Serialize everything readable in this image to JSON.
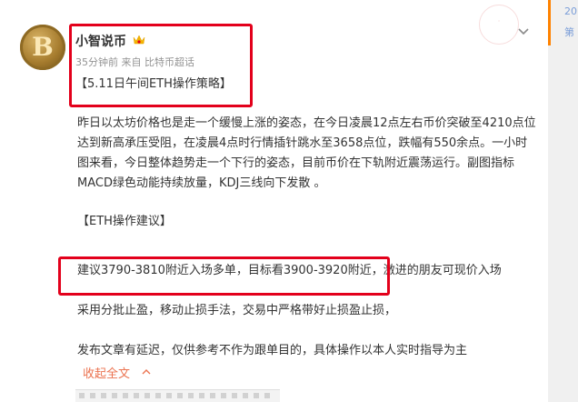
{
  "post": {
    "username": "小智说币",
    "meta": "35分钟前 来自 比特币超话",
    "headline": "【5.11日午间ETH操作策略】",
    "paragraph1": "昨日以太坊价格也是走一个缓慢上涨的姿态，在今日凌晨12点左右币价突破至4210点位达到新高承压受阻，在凌晨4点时行情插针跳水至3658点位，跌幅有550余点。一小时图来看，今日整体趋势走一个下行的姿态，目前币价在下轨附近震荡运行。副图指标MACD绿色动能持续放量，KDJ三线向下发散 。",
    "paragraph2": "【ETH操作建议】",
    "paragraph3": "建议3790-3810附近入场多单，目标看3900-3920附近，激进的朋友可现价入场",
    "paragraph4": "采用分批止盈，移动止损手法，交易中严格带好止损盈止损，",
    "paragraph5": "发布文章有延迟，仅供参考不作为跟单目的，具体操作以本人实时指导为主",
    "collapse_label": "收起全文"
  },
  "sidebar": {
    "line1": "20",
    "line2": "第"
  },
  "icons": {
    "avatar": "bitcoin-avatar",
    "vip": "crown-badge-icon",
    "more": "chevron-down-icon",
    "collapse": "chevron-up-icon"
  },
  "colors": {
    "highlight": "#e3001b",
    "link": "#eb7350",
    "meta": "#939393"
  }
}
